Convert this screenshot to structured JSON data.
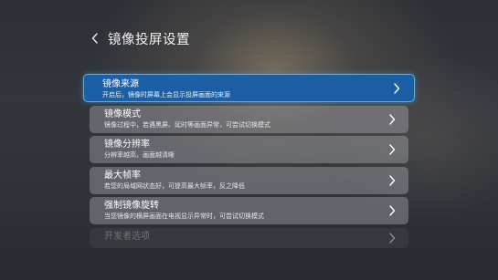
{
  "header": {
    "back_icon": "chevron-left-icon",
    "title": "镜像投屏设置"
  },
  "settings": {
    "items": [
      {
        "title": "镜像来源",
        "subtitle": "开启后，镜像时屏幕上会显示投屏画面的来源",
        "focused": true,
        "icon": "chevron-right-icon"
      },
      {
        "title": "镜像模式",
        "subtitle": "镜像过程中，若遇黑屏、延时等画面异常，可尝试切换模式",
        "icon": "chevron-right-icon"
      },
      {
        "title": "镜像分辨率",
        "subtitle": "分辨率越高，画面越清晰",
        "icon": "chevron-right-icon"
      },
      {
        "title": "最大帧率",
        "subtitle": "若您的局域网状态好，可提高最大帧率，反之降低",
        "icon": "chevron-right-icon"
      },
      {
        "title": "强制镜像旋转",
        "subtitle": "当您镜像的横屏画面在电视显示异常时，可尝试切换模式",
        "icon": "chevron-right-icon"
      },
      {
        "title": "开发者选项",
        "icon": "chevron-right-icon"
      }
    ]
  },
  "colors": {
    "focus_fill": "#1b5fa6",
    "focus_border": "#49b8e8"
  }
}
